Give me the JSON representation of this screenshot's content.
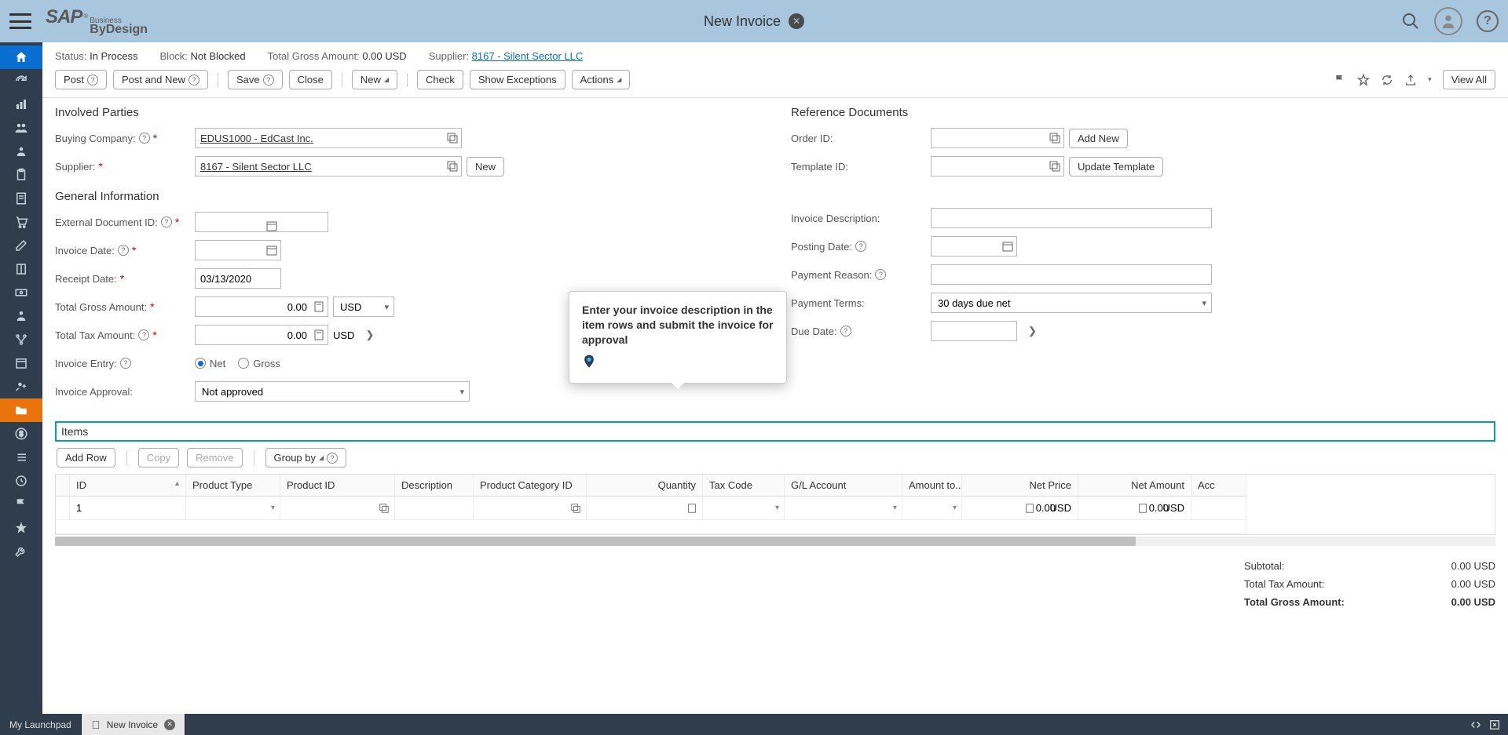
{
  "header": {
    "logo_sap": "SAP",
    "logo_business": "Business",
    "logo_bydesign": "ByDesign",
    "page_title": "New Invoice"
  },
  "status": {
    "status_label": "Status:",
    "status_value": "In Process",
    "block_label": "Block:",
    "block_value": "Not Blocked",
    "total_gross_label": "Total Gross Amount:",
    "total_gross_value": "0.00 USD",
    "supplier_label": "Supplier:",
    "supplier_value": "8167 - Silent Sector LLC"
  },
  "actions": {
    "post": "Post",
    "post_and_new": "Post and New",
    "save": "Save",
    "close": "Close",
    "new": "New",
    "check": "Check",
    "show_exceptions": "Show Exceptions",
    "actions": "Actions",
    "view_all": "View All"
  },
  "involved": {
    "title": "Involved Parties",
    "buying_company_label": "Buying Company:",
    "buying_company_value": "EDUS1000 - EdCast Inc.",
    "supplier_label": "Supplier:",
    "supplier_value": "8167 - Silent Sector LLC",
    "new_btn": "New"
  },
  "reference": {
    "title": "Reference Documents",
    "order_id_label": "Order ID:",
    "add_new": "Add New",
    "template_id_label": "Template ID:",
    "update_template": "Update Template"
  },
  "general": {
    "title": "General Information",
    "external_doc_label": "External Document ID:",
    "invoice_date_label": "Invoice Date:",
    "receipt_date_label": "Receipt Date:",
    "receipt_date_value": "03/13/2020",
    "total_gross_label": "Total Gross Amount:",
    "total_gross_value": "0.00",
    "currency_usd": "USD",
    "total_tax_label": "Total Tax Amount:",
    "total_tax_value": "0.00",
    "invoice_entry_label": "Invoice Entry:",
    "radio_net": "Net",
    "radio_gross": "Gross",
    "invoice_approval_label": "Invoice Approval:",
    "invoice_approval_value": "Not approved"
  },
  "rightcol": {
    "invoice_desc_label": "Invoice Description:",
    "posting_date_label": "Posting Date:",
    "payment_reason_label": "Payment Reason:",
    "payment_terms_label": "Payment Terms:",
    "payment_terms_value": "30 days due net",
    "due_date_label": "Due Date:"
  },
  "tooltip": {
    "text": "Enter your invoice description in the item rows and submit the invoice for approval"
  },
  "items": {
    "title": "Items",
    "add_row": "Add Row",
    "copy": "Copy",
    "remove": "Remove",
    "group_by": "Group by",
    "cols": {
      "id": "ID",
      "product_type": "Product Type",
      "product_id": "Product ID",
      "description": "Description",
      "product_category": "Product Category ID",
      "quantity": "Quantity",
      "tax_code": "Tax Code",
      "gl_account": "G/L Account",
      "amount_to": "Amount to...",
      "net_price": "Net Price",
      "net_amount": "Net Amount",
      "acc": "Acc"
    },
    "row": {
      "id": "1",
      "amount": "0.00",
      "currency1": "USD",
      "net_amount": "0.00",
      "currency2": "USD"
    }
  },
  "totals": {
    "subtotal_label": "Subtotal:",
    "subtotal_value": "0.00 USD",
    "tax_label": "Total Tax Amount:",
    "tax_value": "0.00 USD",
    "gross_label": "Total Gross Amount:",
    "gross_value": "0.00 USD"
  },
  "tabs": {
    "launchpad": "My Launchpad",
    "new_invoice": "New Invoice"
  }
}
